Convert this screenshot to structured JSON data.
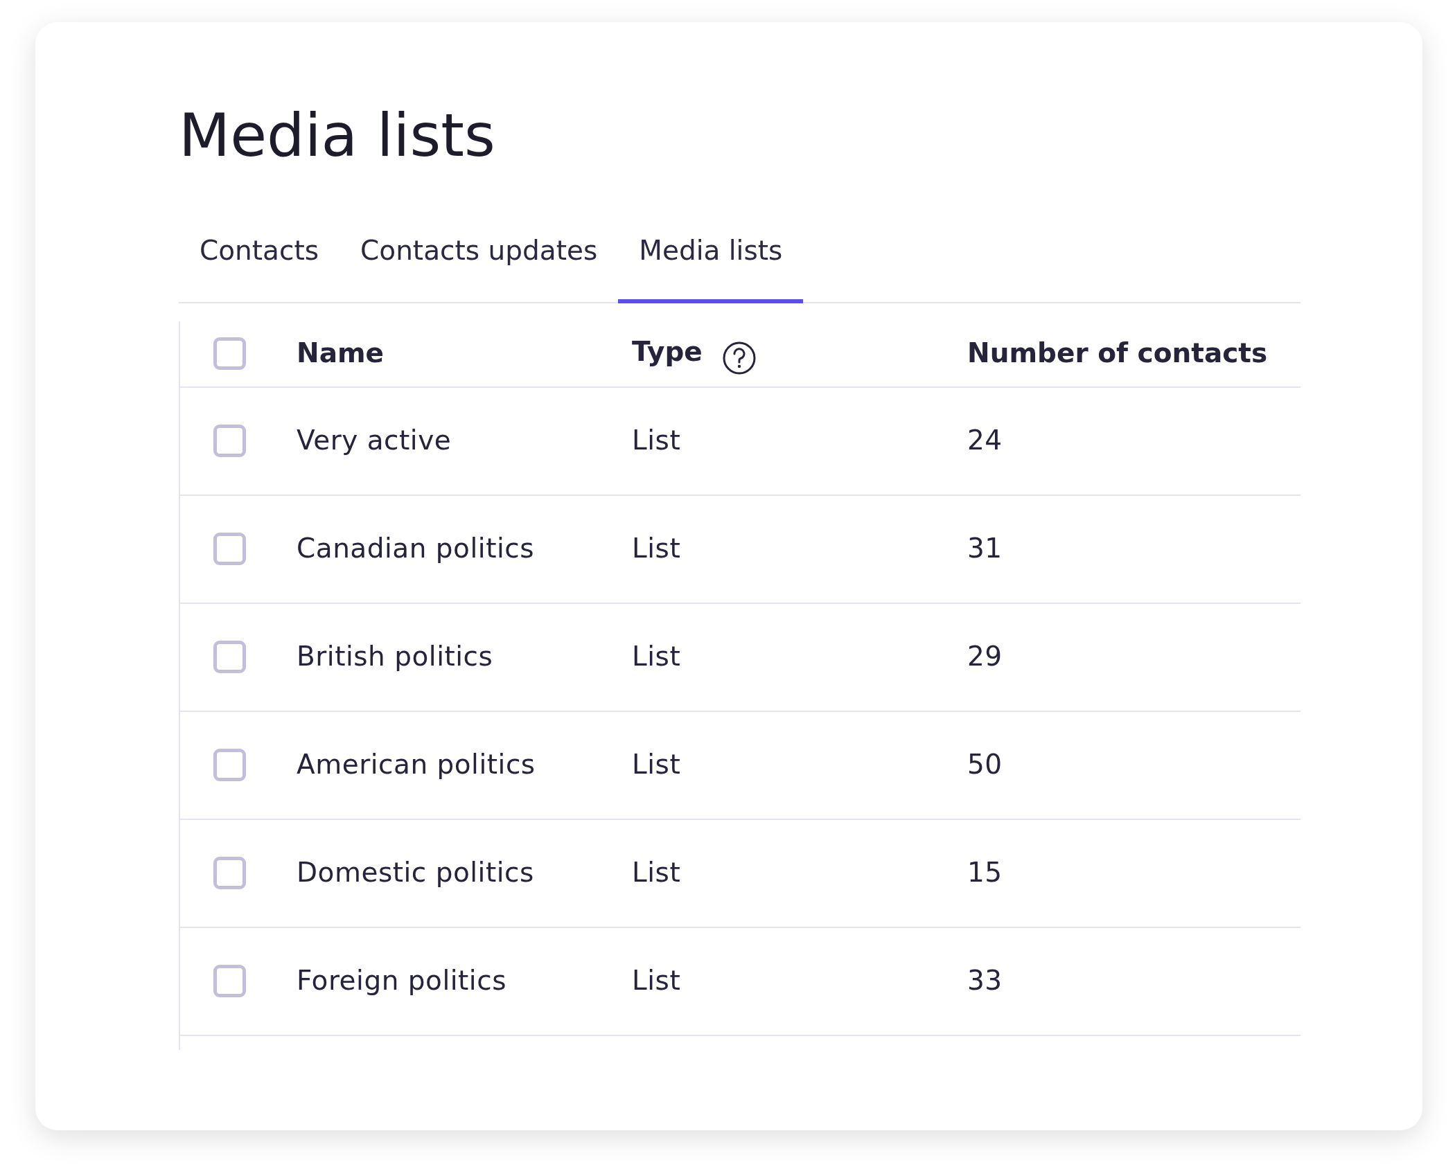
{
  "title": "Media lists",
  "tabs": [
    {
      "label": "Contacts",
      "selected": false
    },
    {
      "label": "Contacts updates",
      "selected": false
    },
    {
      "label": "Media lists",
      "selected": true
    }
  ],
  "table": {
    "select_all": {
      "checked": false
    },
    "columns": [
      "Name",
      "Type",
      "Number of contacts"
    ],
    "rows": [
      {
        "checked": false,
        "cells": [
          "Very active",
          "List",
          "24"
        ]
      },
      {
        "checked": false,
        "cells": [
          "Canadian politics",
          "List",
          "31"
        ]
      },
      {
        "checked": false,
        "cells": [
          "British politics",
          "List",
          "29"
        ]
      },
      {
        "checked": false,
        "cells": [
          "American politics",
          "List",
          "50"
        ]
      },
      {
        "checked": false,
        "cells": [
          "Domestic politics",
          "List",
          "15"
        ]
      },
      {
        "checked": false,
        "cells": [
          "Foreign politics",
          "List",
          "33"
        ]
      }
    ]
  }
}
